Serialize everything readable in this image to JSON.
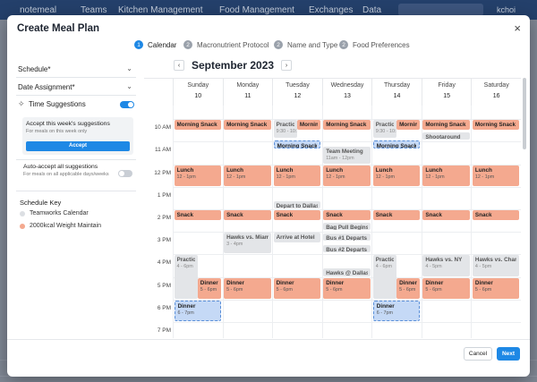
{
  "app": {
    "logo": "notemeal",
    "nav": [
      "Teams",
      "Kitchen Management",
      "Food Management",
      "Exchanges",
      "Data"
    ],
    "user": "kchoi"
  },
  "modal": {
    "title": "Create Meal Plan",
    "close": "×"
  },
  "steps": [
    {
      "num": "1",
      "label": "Calendar",
      "active": true
    },
    {
      "num": "2",
      "label": "Macronutrient Protocol",
      "active": false
    },
    {
      "num": "2",
      "label": "Name and Type",
      "active": false
    },
    {
      "num": "2",
      "label": "Food Preferences",
      "active": false
    }
  ],
  "sidebar": {
    "schedule": "Schedule*",
    "date_assignment": "Date Assignment*",
    "time_suggestions": "Time Suggestions",
    "time_suggestions_on": true,
    "accept_title": "Accept this week's suggestions",
    "accept_sub": "For meals on this week only",
    "accept_button": "Accept",
    "auto_title": "Auto-accept all suggestions",
    "auto_sub": "For meals on all applicable days/weeks",
    "auto_on": false,
    "key_title": "Schedule Key",
    "key_items": [
      {
        "label": "Teamworks Calendar",
        "color": "#dcdfe3"
      },
      {
        "label": "2000kcal Weight Maintain",
        "color": "#f4a98f"
      }
    ]
  },
  "calendar": {
    "month": "September 2023",
    "prev": "‹",
    "next": "›",
    "days": [
      {
        "name": "Sunday",
        "date": "10"
      },
      {
        "name": "Monday",
        "date": "11"
      },
      {
        "name": "Tuesday",
        "date": "12"
      },
      {
        "name": "Wednesday",
        "date": "13"
      },
      {
        "name": "Thursday",
        "date": "14"
      },
      {
        "name": "Friday",
        "date": "15"
      },
      {
        "name": "Saturday",
        "date": "16"
      }
    ],
    "time_labels": [
      "10 AM",
      "11 AM",
      "12 PM",
      "1 PM",
      "2 PM",
      "3 PM",
      "4 PM",
      "5 PM",
      "6 PM",
      "7 PM"
    ],
    "events": [
      {
        "day": 0,
        "name": "Morning Snack",
        "time": "",
        "start": 10.0,
        "end": 10.5,
        "style": "salmon"
      },
      {
        "day": 1,
        "name": "Morning Snack",
        "time": "",
        "start": 10.0,
        "end": 10.5,
        "style": "salmon"
      },
      {
        "day": 2,
        "name": "Practice",
        "time": "9:30 - 10:30am",
        "start": 10.0,
        "end": 10.85,
        "style": "gray",
        "half": "left"
      },
      {
        "day": 2,
        "name": "Morning",
        "time": "",
        "start": 10.0,
        "end": 10.5,
        "style": "salmon",
        "half": "right"
      },
      {
        "day": 2,
        "name": "Morning Snack",
        "time": "",
        "start": 10.9,
        "end": 11.35,
        "style": "blue"
      },
      {
        "day": 3,
        "name": "Morning Snack",
        "time": "",
        "start": 10.0,
        "end": 10.5,
        "style": "salmon"
      },
      {
        "day": 3,
        "name": "Team Meeting",
        "time": "11am - 12pm",
        "start": 11.2,
        "end": 12.0,
        "style": "gray"
      },
      {
        "day": 4,
        "name": "Practice",
        "time": "9:30 - 10:30",
        "start": 10.0,
        "end": 10.85,
        "style": "gray",
        "half": "left"
      },
      {
        "day": 4,
        "name": "Morning",
        "time": "",
        "start": 10.0,
        "end": 10.5,
        "style": "salmon",
        "half": "right"
      },
      {
        "day": 4,
        "name": "Morning Snack",
        "time": "",
        "start": 10.9,
        "end": 11.35,
        "style": "blue"
      },
      {
        "day": 5,
        "name": "Morning Snack",
        "time": "",
        "start": 10.0,
        "end": 10.5,
        "style": "salmon"
      },
      {
        "day": 5,
        "name": "Shootaround",
        "time": "",
        "start": 10.55,
        "end": 10.95,
        "style": "gray"
      },
      {
        "day": 6,
        "name": "Morning Snack",
        "time": "",
        "start": 10.0,
        "end": 10.5,
        "style": "salmon"
      },
      {
        "day": 0,
        "name": "Lunch",
        "time": "12 - 1pm",
        "start": 12.0,
        "end": 13.0,
        "style": "salmon"
      },
      {
        "day": 1,
        "name": "Lunch",
        "time": "12 - 1pm",
        "start": 12.0,
        "end": 13.0,
        "style": "salmon"
      },
      {
        "day": 2,
        "name": "Lunch",
        "time": "12 - 1pm",
        "start": 12.0,
        "end": 13.0,
        "style": "salmon"
      },
      {
        "day": 3,
        "name": "Lunch",
        "time": "12 - 1pm",
        "start": 12.0,
        "end": 13.0,
        "style": "salmon"
      },
      {
        "day": 4,
        "name": "Lunch",
        "time": "12 - 1pm",
        "start": 12.0,
        "end": 13.0,
        "style": "salmon"
      },
      {
        "day": 5,
        "name": "Lunch",
        "time": "12 - 1pm",
        "start": 12.0,
        "end": 13.0,
        "style": "salmon"
      },
      {
        "day": 6,
        "name": "Lunch",
        "time": "12 - 1pm",
        "start": 12.0,
        "end": 13.0,
        "style": "salmon"
      },
      {
        "day": 2,
        "name": "Depart to Dallas",
        "time": "",
        "start": 13.6,
        "end": 14.0,
        "style": "gray"
      },
      {
        "day": 0,
        "name": "Snack",
        "time": "",
        "start": 14.0,
        "end": 14.5,
        "style": "salmon"
      },
      {
        "day": 1,
        "name": "Snack",
        "time": "",
        "start": 14.0,
        "end": 14.5,
        "style": "salmon"
      },
      {
        "day": 2,
        "name": "Snack",
        "time": "",
        "start": 14.0,
        "end": 14.5,
        "style": "salmon"
      },
      {
        "day": 3,
        "name": "Snack",
        "time": "",
        "start": 14.0,
        "end": 14.5,
        "style": "salmon"
      },
      {
        "day": 4,
        "name": "Snack",
        "time": "",
        "start": 14.0,
        "end": 14.5,
        "style": "salmon"
      },
      {
        "day": 5,
        "name": "Snack",
        "time": "",
        "start": 14.0,
        "end": 14.5,
        "style": "salmon"
      },
      {
        "day": 6,
        "name": "Snack",
        "time": "",
        "start": 14.0,
        "end": 14.5,
        "style": "salmon"
      },
      {
        "day": 3,
        "name": "Bag Pull Begins",
        "time": "",
        "start": 14.55,
        "end": 14.95,
        "style": "gray"
      },
      {
        "day": 1,
        "name": "Hawks vs. Miami",
        "time": "3 - 4pm",
        "start": 15.0,
        "end": 16.0,
        "style": "gray"
      },
      {
        "day": 2,
        "name": "Arrive at Hotel",
        "time": "",
        "start": 15.0,
        "end": 15.5,
        "style": "gray"
      },
      {
        "day": 3,
        "name": "Bus #1 Departs",
        "time": "",
        "start": 15.05,
        "end": 15.45,
        "style": "gray"
      },
      {
        "day": 3,
        "name": "Bus #2 Departs",
        "time": "",
        "start": 15.55,
        "end": 15.95,
        "style": "gray"
      },
      {
        "day": 0,
        "name": "Practice",
        "time": "4 - 6pm",
        "start": 16.0,
        "end": 18.0,
        "style": "gray",
        "half": "left"
      },
      {
        "day": 0,
        "name": "Dinner",
        "time": "5 - 6pm",
        "start": 17.0,
        "end": 18.0,
        "style": "salmon",
        "half": "right"
      },
      {
        "day": 0,
        "name": "Dinner",
        "time": "6 - 7pm",
        "start": 18.0,
        "end": 19.0,
        "style": "blue"
      },
      {
        "day": 1,
        "name": "Dinner",
        "time": "5 - 6pm",
        "start": 17.0,
        "end": 18.0,
        "style": "salmon"
      },
      {
        "day": 2,
        "name": "Dinner",
        "time": "5 - 6pm",
        "start": 17.0,
        "end": 18.0,
        "style": "salmon"
      },
      {
        "day": 3,
        "name": "Hawks @ Dallas",
        "time": "",
        "start": 16.6,
        "end": 17.0,
        "style": "gray"
      },
      {
        "day": 3,
        "name": "Dinner",
        "time": "5 - 6pm",
        "start": 17.0,
        "end": 18.0,
        "style": "salmon"
      },
      {
        "day": 4,
        "name": "Practice",
        "time": "4 - 6pm",
        "start": 16.0,
        "end": 18.0,
        "style": "gray",
        "half": "left"
      },
      {
        "day": 4,
        "name": "Dinner",
        "time": "5 - 6pm",
        "start": 17.0,
        "end": 18.0,
        "style": "salmon",
        "half": "right"
      },
      {
        "day": 4,
        "name": "Dinner",
        "time": "6 - 7pm",
        "start": 18.0,
        "end": 19.0,
        "style": "blue"
      },
      {
        "day": 5,
        "name": "Hawks vs. NY",
        "time": "4 - 5pm",
        "start": 16.0,
        "end": 17.0,
        "style": "gray"
      },
      {
        "day": 5,
        "name": "Dinner",
        "time": "5 - 6pm",
        "start": 17.0,
        "end": 18.0,
        "style": "salmon"
      },
      {
        "day": 6,
        "name": "Hawks vs. Charlotte",
        "time": "4 - 5pm",
        "start": 16.0,
        "end": 17.0,
        "style": "gray"
      },
      {
        "day": 6,
        "name": "Dinner",
        "time": "5 - 6pm",
        "start": 17.0,
        "end": 18.0,
        "style": "salmon"
      }
    ]
  },
  "footer": {
    "cancel": "Cancel",
    "next": "Next"
  },
  "colors": {
    "accent": "#1e88e5",
    "meal": "#f4a98f",
    "calendar_event": "#e3e5e8",
    "suggestion": "#c5d9f6"
  }
}
